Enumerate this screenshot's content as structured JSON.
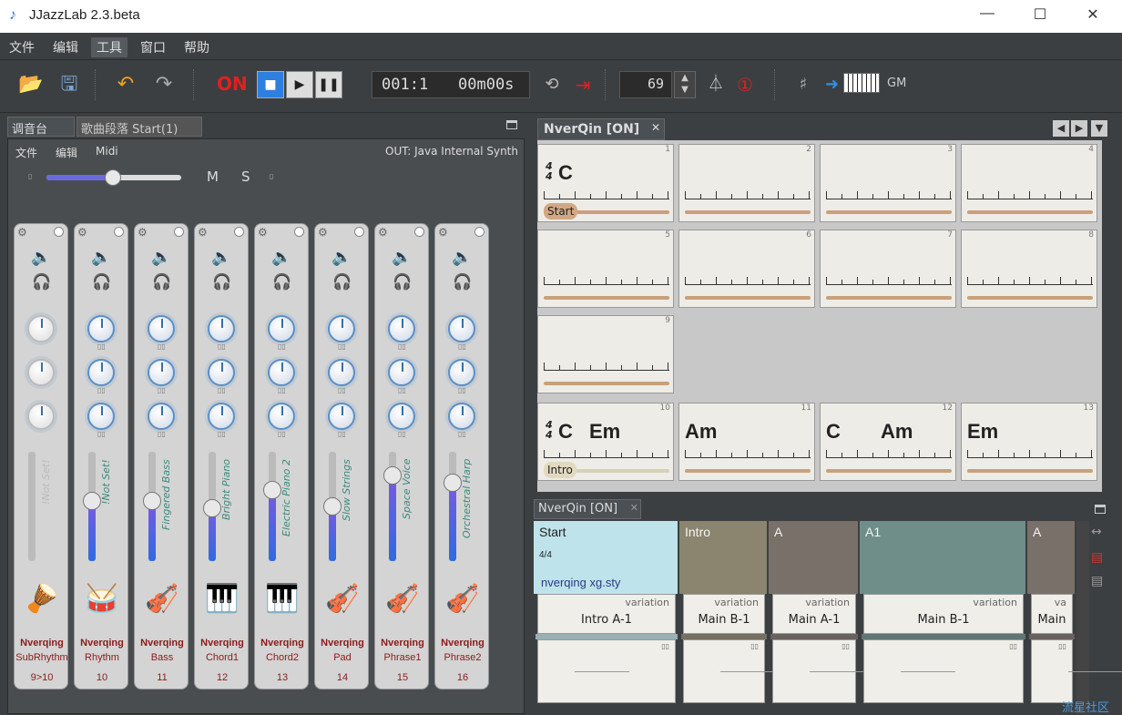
{
  "window": {
    "title": "JJazzLab  2.3.beta"
  },
  "menu": [
    "文件",
    "编辑",
    "工具",
    "窗口",
    "帮助"
  ],
  "toolbar": {
    "on_label": "ON",
    "position": "001:1",
    "time": "00m00s",
    "tempo": "69",
    "midi_label": "GM"
  },
  "left_tabs": [
    "调音台",
    "歌曲段落 Start(1)"
  ],
  "mixer": {
    "menu": [
      "文件",
      "编辑",
      "Midi"
    ],
    "output": "OUT: Java Internal Synth",
    "m_label": "M",
    "s_label": "S",
    "channels": [
      {
        "instrument": "!Not Set!",
        "brand": "Nverqing",
        "part": "SubRhythm",
        "channel": "9>10",
        "icon": "conga-icon",
        "level": 0
      },
      {
        "instrument": "!Not Set!",
        "brand": "Nverqing",
        "part": "Rhythm",
        "channel": "10",
        "icon": "drumkit-icon",
        "level": 0.55
      },
      {
        "instrument": "Fingered Bass",
        "brand": "Nverqing",
        "part": "Bass",
        "channel": "11",
        "icon": "bass-icon",
        "level": 0.55
      },
      {
        "instrument": "Bright Piano",
        "brand": "Nverqing",
        "part": "Chord1",
        "channel": "12",
        "icon": "keyboard-icon",
        "level": 0.48
      },
      {
        "instrument": "Electric Piano 2",
        "brand": "Nverqing",
        "part": "Chord2",
        "channel": "13",
        "icon": "keyboard-icon",
        "level": 0.65
      },
      {
        "instrument": "Slow Strings",
        "brand": "Nverqing",
        "part": "Pad",
        "channel": "14",
        "icon": "violin-icon",
        "level": 0.5
      },
      {
        "instrument": "Space Voice",
        "brand": "Nverqing",
        "part": "Phrase1",
        "channel": "15",
        "icon": "violin-icon",
        "level": 0.78
      },
      {
        "instrument": "Orchestral Harp",
        "brand": "Nverqing",
        "part": "Phrase2",
        "channel": "16",
        "icon": "violin-icon",
        "level": 0.72
      }
    ]
  },
  "sheet": {
    "tab": "NverQin [ON]",
    "bars": [
      {
        "num": "1",
        "chords": [
          "C"
        ],
        "ts": true,
        "tag": "Start"
      },
      {
        "num": "2",
        "chords": []
      },
      {
        "num": "3",
        "chords": []
      },
      {
        "num": "4",
        "chords": []
      },
      {
        "num": "5",
        "chords": []
      },
      {
        "num": "6",
        "chords": []
      },
      {
        "num": "7",
        "chords": []
      },
      {
        "num": "8",
        "chords": []
      },
      {
        "num": "9",
        "chords": []
      },
      {
        "num": "10",
        "chords": [
          "C",
          "Em"
        ],
        "ts": true,
        "tag": "Intro"
      },
      {
        "num": "11",
        "chords": [
          "Am"
        ]
      },
      {
        "num": "12",
        "chords": [
          "C",
          "Am"
        ]
      },
      {
        "num": "13",
        "chords": [
          "Em"
        ]
      }
    ]
  },
  "structure": {
    "tab": "NverQin [ON]",
    "sections": [
      {
        "name": "Start",
        "ts": "4/4",
        "style": "nverqing xg.sty",
        "variation_label": "variation",
        "variation": "Intro A-1",
        "color": "#bfe3ea"
      },
      {
        "name": "Intro",
        "variation_label": "variation",
        "variation": "Main B-1",
        "color": "#8b8570"
      },
      {
        "name": "A",
        "variation_label": "variation",
        "variation": "Main A-1",
        "color": "#7a706a"
      },
      {
        "name": "A1",
        "variation_label": "variation",
        "variation": "Main B-1",
        "color": "#6f8e8a"
      },
      {
        "name": "A",
        "variation_label": "va",
        "variation": "Main",
        "color": "#7a706a"
      }
    ]
  },
  "watermark": "流星社区"
}
